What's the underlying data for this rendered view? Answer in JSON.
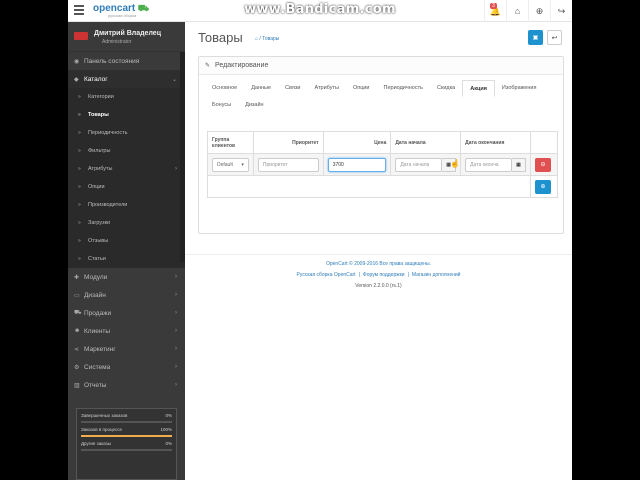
{
  "watermark": "www.Bandicam.com",
  "header": {
    "logo": "opencart",
    "logo_sub": "русская сборка",
    "notif_count": "3"
  },
  "sidebar": {
    "user_name": "Дмитрий Владелец",
    "user_role": "Administrator",
    "items": [
      {
        "label": "Панель состояния"
      },
      {
        "label": "Каталог"
      },
      {
        "label": "Модули"
      },
      {
        "label": "Дизайн"
      },
      {
        "label": "Продажи"
      },
      {
        "label": "Клиенты"
      },
      {
        "label": "Маркетинг"
      },
      {
        "label": "Система"
      },
      {
        "label": "Отчеты"
      }
    ],
    "sub_items": [
      {
        "label": "Категории"
      },
      {
        "label": "Товары"
      },
      {
        "label": "Периодичность"
      },
      {
        "label": "Фильтры"
      },
      {
        "label": "Атрибуты"
      },
      {
        "label": "Опции"
      },
      {
        "label": "Производители"
      },
      {
        "label": "Загрузки"
      },
      {
        "label": "Отзывы"
      },
      {
        "label": "Статьи"
      }
    ],
    "stats": [
      {
        "label": "Завершенных заказов",
        "value": "0%",
        "fill": 0
      },
      {
        "label": "Заказов в процессе",
        "value": "100%",
        "fill": 1
      },
      {
        "label": "Другие заказы",
        "value": "0%",
        "fill": 0
      }
    ]
  },
  "main": {
    "title": "Товары",
    "breadcrumb": "Товары",
    "panel_title": "Редактирование",
    "tabs": [
      "Основное",
      "Данные",
      "Связи",
      "Атрибуты",
      "Опции",
      "Периодичность",
      "Скидка",
      "Акция",
      "Изображения",
      "Бонусы",
      "Дизайн"
    ],
    "active_tab": "Акция",
    "table": {
      "headers": [
        "Группа клиентов",
        "Приоритет",
        "Цена",
        "Дата начала",
        "Дата окончания"
      ],
      "row": {
        "group": "Default",
        "priority_placeholder": "Приоритет",
        "price": "3700",
        "date_start_placeholder": "Дата начала",
        "date_end_placeholder": "Дата оконча"
      }
    }
  },
  "footer": {
    "copyright": "OpenCart © 2009-2016 Все права защищены.",
    "link1": "Русская сборка OpenCart",
    "link2": "Форум поддержки",
    "link3": "Магазин дополнений",
    "version": "Version 2.2.0.0 (rs.1)"
  }
}
